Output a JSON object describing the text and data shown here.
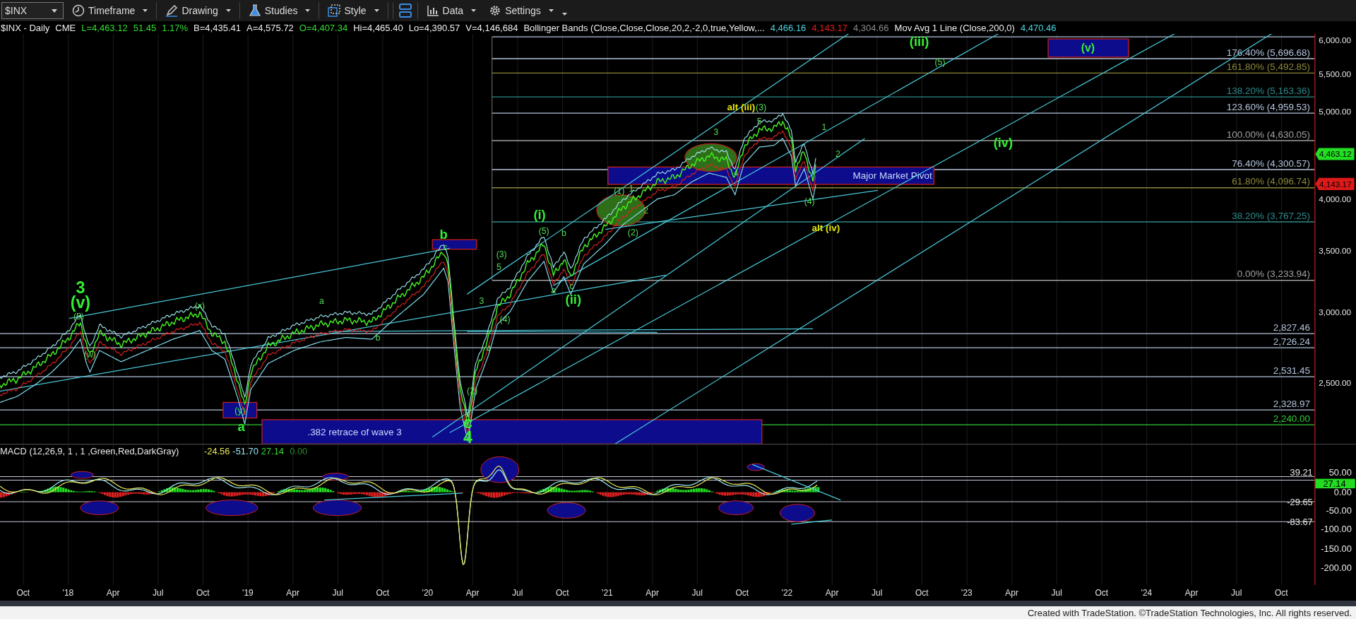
{
  "toolbar": {
    "symbol": "$INX",
    "buttons": [
      {
        "label": "Timeframe",
        "kind": "timeframe"
      },
      {
        "label": "Drawing",
        "kind": "drawing"
      },
      {
        "label": "Studies",
        "kind": "studies"
      },
      {
        "label": "Style",
        "kind": "style"
      },
      {
        "label": "Data",
        "kind": "data"
      },
      {
        "label": "Settings",
        "kind": "settings"
      }
    ]
  },
  "info_bar": {
    "symbol_label": "$INX - Daily",
    "exchange": "CME",
    "last": "L=4,463.12",
    "change": "51.45",
    "change_pct": "1.17%",
    "bid": "B=4,435.41",
    "ask": "A=4,575.72",
    "open": "O=4,407.34",
    "high": "Hi=4,465.40",
    "low": "Lo=4,390.57",
    "volume": "V=4,146,684",
    "study": "Bollinger Bands (Close,Close,Close,20,2,-2,0,true,Yellow,...",
    "study_values": [
      {
        "text": "4,466.16",
        "color": "#4fd2e0"
      },
      {
        "text": "4,143.17",
        "color": "#e02020"
      },
      {
        "text": "4,304.66",
        "color": "#8a8a8a"
      }
    ],
    "ma_label": "Mov Avg 1 Line (Close,200,0)",
    "ma_value": "4,470.46"
  },
  "price_panel": {
    "price_axis": [
      "6,000.00",
      "5,500.00",
      "5,000.00",
      "4,000.00",
      "3,500.00",
      "3,000.00",
      "2,500.00"
    ],
    "last_price_tag": "4,463.12",
    "band_tag": "4,143.17",
    "levels": [
      {
        "label": "176.40% (5,696.68)",
        "color": "#b4c4dc"
      },
      {
        "label": "161.80% (5,492.85)",
        "color": "#8c883a"
      },
      {
        "label": "138.20% (5,163.36)",
        "color": "#2e8a8a"
      },
      {
        "label": "123.60% (4,959.53)",
        "color": "#b4c4dc"
      },
      {
        "label": "100.00% (4,630.05)",
        "color": "#a0a0a0"
      },
      {
        "label": "76.40% (4,300.57)",
        "color": "#b4c4dc"
      },
      {
        "label": "61.80% (4,096.74)",
        "color": "#8c883a"
      },
      {
        "label": "38.20% (3,767.25)",
        "color": "#2e8a8a"
      },
      {
        "label": "0.00% (3,233.94)",
        "color": "#a0a0a0"
      },
      {
        "label": "2,827.46",
        "color": "#b4c4dc"
      },
      {
        "label": "2,726.24",
        "color": "#b4c4dc"
      },
      {
        "label": "2,531.45",
        "color": "#b4c4dc"
      },
      {
        "label": "2,328.97",
        "color": "#b4c4dc"
      },
      {
        "label": "2,240.00",
        "color": "#33cc33"
      }
    ],
    "zones": [
      {
        "label": "(y)"
      },
      {
        "label": ".382 retrace of wave 3"
      },
      {
        "label": "Major Market Pivot"
      },
      {
        "label": "(v)"
      }
    ],
    "wave_labels": [
      {
        "text": "3",
        "kind": "primary"
      },
      {
        "text": "(v)",
        "kind": "primary"
      },
      {
        "text": "(5)",
        "kind": "minor"
      },
      {
        "text": "(w)",
        "kind": "minor"
      },
      {
        "text": "(x)",
        "kind": "minor"
      },
      {
        "text": "a",
        "kind": "major"
      },
      {
        "text": "a",
        "kind": "minor"
      },
      {
        "text": "b",
        "kind": "minor"
      },
      {
        "text": "b",
        "kind": "major"
      },
      {
        "text": "c",
        "kind": "minor"
      },
      {
        "text": "(2)",
        "kind": "minor"
      },
      {
        "text": "c",
        "kind": "primary"
      },
      {
        "text": "4",
        "kind": "primary"
      },
      {
        "text": "4",
        "kind": "minor"
      },
      {
        "text": "(4)",
        "kind": "minor"
      },
      {
        "text": "3",
        "kind": "minor"
      },
      {
        "text": "(3)",
        "kind": "minor"
      },
      {
        "text": "5",
        "kind": "minor"
      },
      {
        "text": "(i)",
        "kind": "major"
      },
      {
        "text": "(5)",
        "kind": "minor"
      },
      {
        "text": "b",
        "kind": "minor"
      },
      {
        "text": "a",
        "kind": "minor"
      },
      {
        "text": "c",
        "kind": "minor"
      },
      {
        "text": "(ii)",
        "kind": "major"
      },
      {
        "text": "(1)",
        "kind": "minor"
      },
      {
        "text": "1",
        "kind": "minor"
      },
      {
        "text": "2",
        "kind": "minor"
      },
      {
        "text": "(2)",
        "kind": "minor"
      },
      {
        "text": "3",
        "kind": "minor"
      },
      {
        "text": "4",
        "kind": "minor"
      },
      {
        "text": "5",
        "kind": "minor"
      },
      {
        "text": "alt (iii)",
        "kind": "alt"
      },
      {
        "text": "(3)",
        "kind": "minor"
      },
      {
        "text": "(iii)",
        "kind": "major"
      },
      {
        "text": "(5)",
        "kind": "minor"
      },
      {
        "text": "1",
        "kind": "minor"
      },
      {
        "text": "2",
        "kind": "minor"
      },
      {
        "text": "(iv)",
        "kind": "major"
      },
      {
        "text": "(4)",
        "kind": "minor"
      },
      {
        "text": "alt (iv)",
        "kind": "alt"
      }
    ]
  },
  "macd_panel": {
    "title": "MACD (12,26,9, 1 , 1 ,Green,Red,DarkGray)",
    "values": [
      {
        "text": "-24.56",
        "color": "#e8e85a"
      },
      {
        "text": "-51.70",
        "color": "#9ee8f0"
      },
      {
        "text": "27.14",
        "color": "#33dd33"
      },
      {
        "text": "0.00",
        "color": "#2a8a2a"
      }
    ],
    "axis": [
      "50.00",
      "0.00",
      "-50.00",
      "-100.00",
      "-150.00",
      "-200.00"
    ],
    "levels": [
      "39.21",
      "-29.65",
      "-83.67"
    ],
    "value_tag": "27.14"
  },
  "time_axis": [
    "Oct",
    "'18",
    "Apr",
    "Jul",
    "Oct",
    "'19",
    "Apr",
    "Jul",
    "Oct",
    "'20",
    "Apr",
    "Jul",
    "Oct",
    "'21",
    "Apr",
    "Jul",
    "Oct",
    "'22",
    "Apr",
    "Jul",
    "Oct",
    "'23",
    "Apr",
    "Jul",
    "Oct",
    "'24",
    "Apr",
    "Jul",
    "Oct"
  ],
  "footer": "Created with TradeStation. ©TradeStation Technologies, Inc. All rights reserved."
}
